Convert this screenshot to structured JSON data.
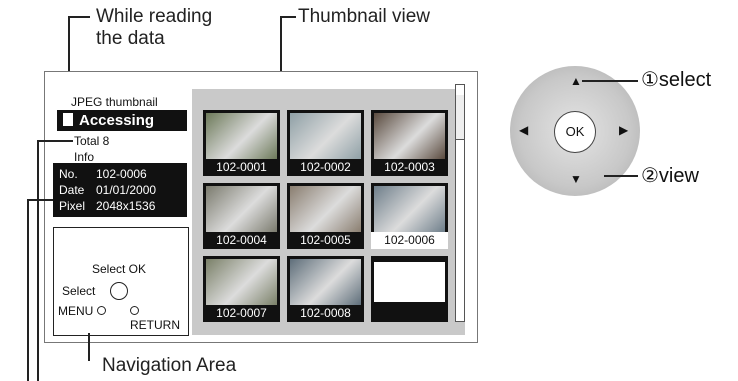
{
  "callouts": {
    "while_reading": "While reading\nthe data",
    "thumbnail_view": "Thumbnail view",
    "navigation_area": "Navigation Area"
  },
  "screen": {
    "mode_label": "JPEG thumbnail",
    "status": "Accessing",
    "total": "Total 8",
    "info_label": "Info",
    "info": {
      "no_label": "No.",
      "no_value": "102-0006",
      "date_label": "Date",
      "date_value": "01/01/2000",
      "pixel_label": "Pixel",
      "pixel_value": "2048x1536"
    },
    "nav": {
      "select_ok": "Select  OK",
      "select": "Select",
      "menu": "MENU",
      "return": "RETURN"
    },
    "thumbnails": [
      {
        "label": "102-0001"
      },
      {
        "label": "102-0002"
      },
      {
        "label": "102-0003"
      },
      {
        "label": "102-0004"
      },
      {
        "label": "102-0005"
      },
      {
        "label": "102-0006"
      },
      {
        "label": "102-0007"
      },
      {
        "label": "102-0008"
      },
      {
        "label": ""
      }
    ]
  },
  "remote": {
    "ok": "OK",
    "select_callout": "①select",
    "view_callout": "②view"
  }
}
